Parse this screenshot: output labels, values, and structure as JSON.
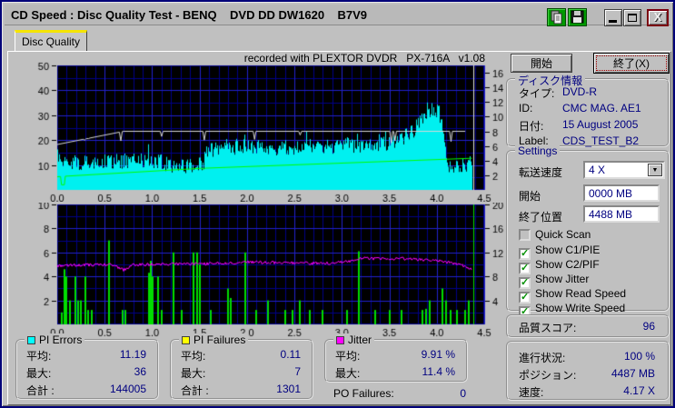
{
  "window": {
    "title": "CD Speed : Disc Quality Test - BENQ    DVD DD DW1620    B7V9"
  },
  "tab": {
    "label": "Disc Quality"
  },
  "chart_header": "recorded with PLEXTOR DVDR   PX-716A   v1.08",
  "buttons": {
    "start_label": "開始",
    "exit_label": "終了(X)"
  },
  "disc_info": {
    "title": "ディスク情報",
    "rows": [
      {
        "label": "タイプ:",
        "value": "DVD-R"
      },
      {
        "label": "ID:",
        "value": "CMC MAG. AE1"
      },
      {
        "label": "日付:",
        "value": "15 August 2005"
      },
      {
        "label": "Label:",
        "value": "CDS_TEST_B2"
      }
    ]
  },
  "settings": {
    "title": "Settings",
    "speed_label": "転送速度",
    "speed_value": "4 X",
    "start_label": "開始",
    "start_value": "0000 MB",
    "end_label": "終了位置",
    "end_value": "4488 MB",
    "checkboxes": [
      {
        "label": "Quick Scan",
        "mark": "",
        "disabled": true
      },
      {
        "label": "Show C1/PIE",
        "mark": "✓"
      },
      {
        "label": "Show C2/PIF",
        "mark": "✓"
      },
      {
        "label": "Show Jitter",
        "mark": "✓"
      },
      {
        "label": "Show Read Speed",
        "mark": "✓"
      },
      {
        "label": "Show Write Speed",
        "mark": "✓"
      }
    ]
  },
  "quality": {
    "label": "品質スコア:",
    "value": "96"
  },
  "progress": {
    "rows": [
      {
        "label": "進行状況:",
        "value": "100 %"
      },
      {
        "label": "ポジション:",
        "value": "4487 MB"
      },
      {
        "label": "速度:",
        "value": "4.17 X"
      }
    ]
  },
  "stats": {
    "pi_errors": {
      "title": "PI Errors",
      "color": "#00ffff",
      "rows": [
        {
          "label": "平均:",
          "value": "11.19"
        },
        {
          "label": "最大:",
          "value": "36"
        },
        {
          "label": "合計 :",
          "value": "144005"
        }
      ]
    },
    "pi_failures": {
      "title": "PI Failures",
      "color": "#ffff00",
      "rows": [
        {
          "label": "平均:",
          "value": "0.11"
        },
        {
          "label": "最大:",
          "value": "7"
        },
        {
          "label": "合計 :",
          "value": "1301"
        }
      ]
    },
    "jitter": {
      "title": "Jitter",
      "color": "#ff00ff",
      "rows": [
        {
          "label": "平均:",
          "value": "9.91 %"
        },
        {
          "label": "最大:",
          "value": "11.4 %"
        }
      ]
    },
    "po_failures": {
      "label": "PO Failures:",
      "value": "0"
    }
  },
  "chart_data": [
    {
      "type": "area",
      "title": "PI Errors with Read/Write Speed",
      "plot_bg": "#000000",
      "grid_minor": "#000088",
      "grid_major": "#2222cc",
      "x_axis": {
        "max": 4.5,
        "major": 0.5,
        "minor": 0.1,
        "tick_labels": [
          "0.0",
          "0.5",
          "1.0",
          "1.5",
          "2.0",
          "2.5",
          "3.0",
          "3.5",
          "4.0",
          "4.5"
        ]
      },
      "left_axis": {
        "max": 50,
        "ticks": [
          10,
          20,
          30,
          40,
          50
        ],
        "minor_step": 5
      },
      "right_axis": {
        "max": 17,
        "ticks": [
          2,
          4,
          6,
          8,
          10,
          12,
          14,
          16
        ]
      },
      "end_x": 4.37,
      "end_marker_color": "#e0e0e0",
      "series": [
        {
          "name": "pi_errors",
          "type": "area",
          "axis": "left",
          "color": "#00f0f0",
          "noise": 3.2,
          "spike_chance": 0.06,
          "spike_extra": 5,
          "points": [
            [
              0,
              15
            ],
            [
              0.05,
              11
            ],
            [
              0.3,
              11
            ],
            [
              0.6,
              11.5
            ],
            [
              0.9,
              11.5
            ],
            [
              1.0,
              12
            ],
            [
              1.2,
              10
            ],
            [
              1.4,
              9.5
            ],
            [
              1.54,
              10
            ],
            [
              1.56,
              16
            ],
            [
              1.8,
              17
            ],
            [
              2.0,
              17
            ],
            [
              2.3,
              17
            ],
            [
              2.6,
              17.5
            ],
            [
              3.0,
              17.5
            ],
            [
              3.3,
              18
            ],
            [
              3.5,
              19
            ],
            [
              3.6,
              20
            ],
            [
              3.7,
              22
            ],
            [
              3.8,
              26
            ],
            [
              3.9,
              30
            ],
            [
              3.95,
              32
            ],
            [
              4.0,
              32
            ],
            [
              4.05,
              29
            ],
            [
              4.08,
              20
            ],
            [
              4.12,
              9
            ],
            [
              4.2,
              9
            ],
            [
              4.3,
              10
            ],
            [
              4.37,
              11
            ]
          ]
        },
        {
          "name": "read_speed",
          "type": "line",
          "axis": "right",
          "color": "#00ff00",
          "points": [
            [
              0,
              1.8
            ],
            [
              0.035,
              1.82
            ],
            [
              0.045,
              0.7
            ],
            [
              0.075,
              0.7
            ],
            [
              0.085,
              1.87
            ],
            [
              1.52,
              2.95
            ],
            [
              1.54,
              2.82
            ],
            [
              1.56,
              2.97
            ],
            [
              4.37,
              4.32
            ]
          ]
        },
        {
          "name": "write_speed",
          "type": "line",
          "axis": "right",
          "color": "#d8d8d8",
          "points": [
            [
              0,
              6.2
            ],
            [
              0.7,
              8
            ],
            [
              4.3,
              8
            ]
          ],
          "dips": [
            [
              0.29,
              6.8
            ],
            [
              0.33,
              7.0
            ],
            [
              0.67,
              6.7
            ],
            [
              1.1,
              7.3
            ],
            [
              1.55,
              6.8
            ],
            [
              2.08,
              6.9
            ],
            [
              2.56,
              7.5
            ],
            [
              3.52,
              6.4
            ],
            [
              3.56,
              6.7
            ],
            [
              4.15,
              6.6
            ]
          ]
        }
      ]
    },
    {
      "type": "bars",
      "title": "PI Failures and Jitter",
      "plot_bg": "#000000",
      "grid_minor": "#000088",
      "grid_major": "#2222cc",
      "x_axis": {
        "max": 4.5,
        "major": 0.5,
        "minor": 0.1,
        "tick_labels": [
          "0.0",
          "0.5",
          "1.0",
          "1.5",
          "2.0",
          "2.5",
          "3.0",
          "3.5",
          "4.0",
          "4.5"
        ]
      },
      "left_axis": {
        "max": 10,
        "ticks": [
          2,
          4,
          6,
          8,
          10
        ],
        "minor_step": 1
      },
      "right_axis": {
        "max": 20,
        "ticks": [
          4,
          8,
          12,
          16,
          20
        ]
      },
      "end_x": 4.37,
      "end_marker_color": "#00dd00",
      "series": [
        {
          "name": "pi_failures",
          "type": "bars",
          "axis": "left",
          "color": "#00dd00",
          "bars": [
            [
              0.05,
              1
            ],
            [
              0.08,
              4.6
            ],
            [
              0.1,
              4.0
            ],
            [
              0.13,
              2.0
            ],
            [
              0.19,
              4.0
            ],
            [
              0.22,
              2.0
            ],
            [
              0.25,
              2.0
            ],
            [
              0.3,
              4.0
            ],
            [
              0.33,
              1.2
            ],
            [
              0.36,
              1.2
            ],
            [
              0.55,
              7.0
            ],
            [
              0.69,
              1.2
            ],
            [
              0.72,
              1.2
            ],
            [
              0.97,
              4.3
            ],
            [
              0.99,
              5.3
            ],
            [
              1.01,
              4.0
            ],
            [
              1.06,
              4.0
            ],
            [
              1.1,
              1.2
            ],
            [
              1.23,
              6.0
            ],
            [
              1.31,
              1.2
            ],
            [
              1.44,
              6.0
            ],
            [
              1.47,
              6.0
            ],
            [
              1.5,
              5.0
            ],
            [
              1.62,
              1.2
            ],
            [
              1.8,
              3.0
            ],
            [
              1.83,
              2.2
            ],
            [
              1.98,
              6.0
            ],
            [
              2.1,
              1.2
            ],
            [
              2.22,
              2.0
            ],
            [
              2.4,
              1.2
            ],
            [
              2.48,
              1.2
            ],
            [
              2.56,
              2.0
            ],
            [
              2.66,
              1.2
            ],
            [
              2.8,
              1.2
            ],
            [
              3.05,
              1.2
            ],
            [
              3.18,
              6.1
            ],
            [
              3.35,
              1.2
            ],
            [
              3.5,
              1.2
            ],
            [
              3.63,
              1.2
            ],
            [
              3.85,
              1.2
            ],
            [
              3.89,
              1.3
            ],
            [
              3.93,
              2.0
            ],
            [
              4.06,
              3.0
            ],
            [
              4.1,
              2.0
            ],
            [
              4.15,
              1.2
            ],
            [
              4.21,
              1.2
            ],
            [
              4.3,
              1.2
            ],
            [
              4.34,
              2.0
            ]
          ]
        },
        {
          "name": "jitter",
          "type": "noisyline",
          "axis": "left",
          "color": "#ff00ff",
          "noise": 0.12,
          "points": [
            [
              0,
              4.9
            ],
            [
              0.3,
              4.95
            ],
            [
              0.55,
              5.0
            ],
            [
              0.7,
              4.55
            ],
            [
              0.8,
              4.95
            ],
            [
              1.0,
              5.0
            ],
            [
              1.3,
              5.05
            ],
            [
              1.5,
              5.05
            ],
            [
              1.8,
              5.1
            ],
            [
              2.0,
              5.2
            ],
            [
              2.3,
              5.15
            ],
            [
              2.6,
              5.1
            ],
            [
              2.9,
              5.1
            ],
            [
              3.1,
              5.3
            ],
            [
              3.2,
              5.55
            ],
            [
              3.4,
              5.45
            ],
            [
              3.6,
              5.5
            ],
            [
              3.8,
              5.4
            ],
            [
              4.0,
              5.35
            ],
            [
              4.1,
              5.2
            ],
            [
              4.25,
              5.0
            ],
            [
              4.37,
              4.6
            ]
          ]
        }
      ]
    }
  ]
}
